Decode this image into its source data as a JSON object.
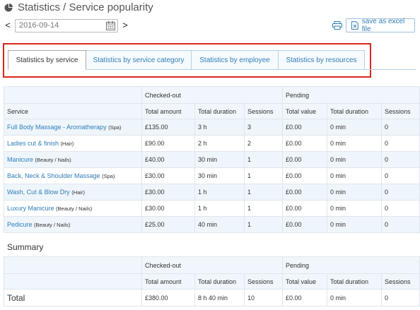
{
  "page": {
    "title": "Statistics / Service popularity"
  },
  "date_picker": {
    "value": "2016-09-14",
    "prev_label": "<",
    "next_label": ">"
  },
  "toolbar": {
    "excel_label": "save as excel file"
  },
  "tabs": [
    {
      "label": "Statistics by service",
      "active": true
    },
    {
      "label": "Statistics by service category",
      "active": false
    },
    {
      "label": "Statistics by employee",
      "active": false
    },
    {
      "label": "Statistics by resources",
      "active": false
    }
  ],
  "table": {
    "group_headers": {
      "checked_out": "Checked-out",
      "pending": "Pending"
    },
    "columns": {
      "service": "Service",
      "total_amount": "Total amount",
      "total_duration": "Total duration",
      "sessions": "Sessions",
      "total_value": "Total value",
      "pending_total_duration": "Total duration",
      "pending_sessions": "Sessions"
    },
    "rows": [
      {
        "service": "Full Body Massage - Aromatherapy",
        "category": "(Spa)",
        "amount": "£135.00",
        "duration": "3 h",
        "sessions": "3",
        "p_value": "£0.00",
        "p_duration": "0 min",
        "p_sessions": "0"
      },
      {
        "service": "Ladies cut & finish",
        "category": "(Hair)",
        "amount": "£90.00",
        "duration": "2 h",
        "sessions": "2",
        "p_value": "£0.00",
        "p_duration": "0 min",
        "p_sessions": "0"
      },
      {
        "service": "Manicure",
        "category": "(Beauty / Nails)",
        "amount": "£40.00",
        "duration": "30 min",
        "sessions": "1",
        "p_value": "£0.00",
        "p_duration": "0 min",
        "p_sessions": "0"
      },
      {
        "service": "Back, Neck & Shoulder Massage",
        "category": "(Spa)",
        "amount": "£30.00",
        "duration": "30 min",
        "sessions": "1",
        "p_value": "£0.00",
        "p_duration": "0 min",
        "p_sessions": "0"
      },
      {
        "service": "Wash, Cut & Blow Dry",
        "category": "(Hair)",
        "amount": "£30.00",
        "duration": "1 h",
        "sessions": "1",
        "p_value": "£0.00",
        "p_duration": "0 min",
        "p_sessions": "0"
      },
      {
        "service": "Luxury Manicure",
        "category": "(Beauty / Nails)",
        "amount": "£30.00",
        "duration": "1 h",
        "sessions": "1",
        "p_value": "£0.00",
        "p_duration": "0 min",
        "p_sessions": "0"
      },
      {
        "service": "Pedicure",
        "category": "(Beauty / Nails)",
        "amount": "£25.00",
        "duration": "40 min",
        "sessions": "1",
        "p_value": "£0.00",
        "p_duration": "0 min",
        "p_sessions": "0"
      }
    ]
  },
  "summary": {
    "title": "Summary",
    "total_label": "Total",
    "amount": "£380.00",
    "duration": "8 h 40 min",
    "sessions": "10",
    "p_value": "£0.00",
    "p_duration": "0 min",
    "p_sessions": "0"
  },
  "colors": {
    "accent": "#2f7db8",
    "highlight_border": "#d9251d",
    "header_bg": "#f0f6fb",
    "alt_row_bg": "#eef5fb"
  }
}
